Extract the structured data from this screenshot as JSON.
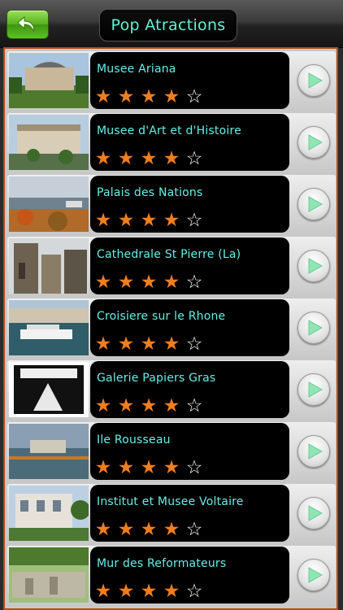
{
  "header": {
    "title": "Pop Atractions",
    "back_icon": "back-arrow-icon"
  },
  "colors": {
    "accent": "#5ff2d6",
    "star_on": "#f07e1e",
    "back_green": "#56b01c",
    "frame": "#b84a10"
  },
  "items": [
    {
      "name": "Musee Ariana",
      "rating": 4,
      "max_rating": 5
    },
    {
      "name": "Musee d'Art et d'Histoire",
      "rating": 4,
      "max_rating": 5
    },
    {
      "name": "Palais des Nations",
      "rating": 4,
      "max_rating": 5
    },
    {
      "name": "Cathedrale St Pierre (La)",
      "rating": 4,
      "max_rating": 5
    },
    {
      "name": "Croisiere sur le Rhone",
      "rating": 4,
      "max_rating": 5
    },
    {
      "name": "Galerie Papiers Gras",
      "rating": 4,
      "max_rating": 5
    },
    {
      "name": "Ile Rousseau",
      "rating": 4,
      "max_rating": 5
    },
    {
      "name": "Institut et Musee Voltaire",
      "rating": 4,
      "max_rating": 5
    },
    {
      "name": "Mur des Reformateurs",
      "rating": 4,
      "max_rating": 5
    }
  ]
}
